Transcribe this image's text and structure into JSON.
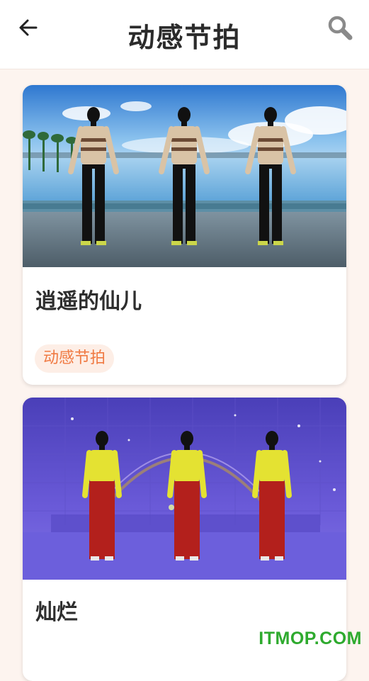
{
  "header": {
    "title": "动感节拍",
    "back_icon": "arrow-left-icon",
    "search_icon": "search-icon"
  },
  "videos": [
    {
      "title": "逍遥的仙儿",
      "tag": "动感节拍",
      "scene": "three dancers on a lakeside stage under blue sky"
    },
    {
      "title": "灿烂",
      "scene": "three dancers in yellow and red on a purple stage"
    }
  ],
  "watermark": "ITMOP.COM",
  "colors": {
    "background": "#fdf4ef",
    "tag_text": "#f07a43",
    "tag_bg": "#fdeee6",
    "watermark": "#2eaa2e"
  }
}
